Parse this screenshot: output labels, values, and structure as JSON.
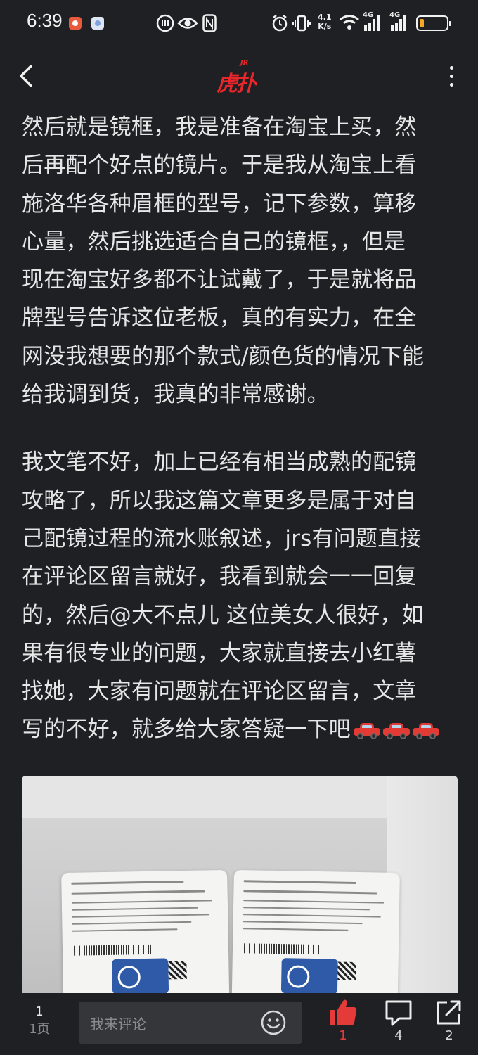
{
  "status_bar": {
    "time": "6:39",
    "net_speed_top": "4.1",
    "net_speed_bottom": "K/s",
    "sig1_label": "4G",
    "sig2_label": "4G",
    "battery_level": 0.18,
    "battery_color": "#f5a623"
  },
  "nav": {
    "back_icon": "chevron-left-icon",
    "logo_text": "虎扑",
    "logo_sup": "JR",
    "more_icon": "more-vertical-icon"
  },
  "article": {
    "para1": "然后就是镜框，我是准备在淘宝上买，然\n后再配个好点的镜片。于是我从淘宝上看\n施洛华各种眉框的型号，记下参数，算移\n心量，然后挑选适合自己的镜框，，但是\n现在淘宝好多都不让试戴了，于是就将品\n牌型号告诉这位老板，真的有实力，在全\n网没我想要的那个款式/颜色货的情况下能\n给我调到货，我真的非常感谢。",
    "para2": "我文笔不好，加上已经有相当成熟的配镜\n攻略了，所以我这篇文章更多是属于对自\n己配镜过程的流水账叙述，jrs有问题直接\n在评论区留言就好，我看到就会一一回复\n的，然后@大不点儿 这位美女人很好，如\n果有很专业的问题，大家就直接去小红薯\n找她，大家有问题就在评论区留言，文章\n写的不好，就多给大家答疑一下吧",
    "emoji": "red-car-icon"
  },
  "bottom_bar": {
    "page_number": "1",
    "page_label": "1页",
    "comment_placeholder": "我来评论",
    "like_count": "1",
    "comment_count": "4",
    "share_count": "2",
    "accent_color": "#e53a3a"
  }
}
